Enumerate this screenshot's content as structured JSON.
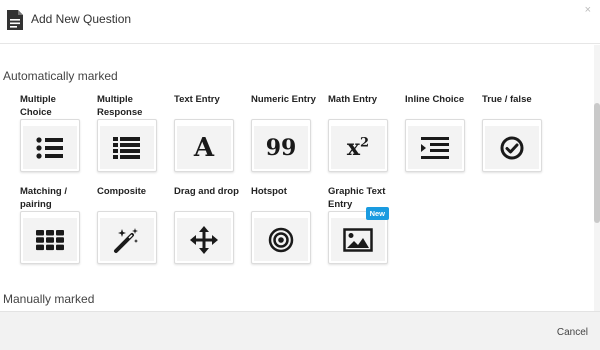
{
  "dialog": {
    "title": "Add New Question",
    "close_label": "×",
    "cancel_label": "Cancel"
  },
  "sections": {
    "auto": "Automatically marked",
    "manual": "Manually marked"
  },
  "questions": [
    {
      "label": "Multiple Choice",
      "icon": "list-bullets-icon"
    },
    {
      "label": "Multiple Response",
      "icon": "list-icon"
    },
    {
      "label": "Text Entry",
      "icon": "letter-a-icon",
      "glyph": "A"
    },
    {
      "label": "Numeric Entry",
      "icon": "number-icon",
      "glyph": "99"
    },
    {
      "label": "Math Entry",
      "icon": "superscript-icon",
      "glyph": "x",
      "sup": "2"
    },
    {
      "label": "Inline Choice",
      "icon": "indent-icon"
    },
    {
      "label": "True / false",
      "icon": "check-circle-icon"
    },
    {
      "label": "Matching / pairing",
      "icon": "grid-icon"
    },
    {
      "label": "Composite",
      "icon": "magic-wand-icon"
    },
    {
      "label": "Drag and drop",
      "icon": "move-arrows-icon"
    },
    {
      "label": "Hotspot",
      "icon": "target-icon"
    },
    {
      "label": "Graphic Text Entry",
      "icon": "image-icon",
      "badge": "New"
    }
  ],
  "colors": {
    "badge": "#1a9be0",
    "tile_bg": "#f3f3f3",
    "footer_bg": "#f2f2f2"
  }
}
